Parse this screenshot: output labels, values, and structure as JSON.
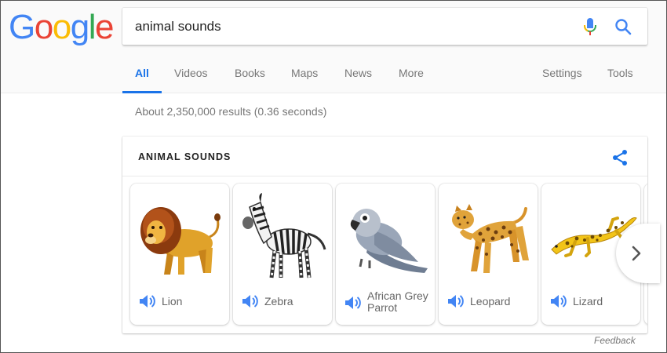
{
  "logo": {
    "text": "Google",
    "letters": [
      "G",
      "o",
      "o",
      "g",
      "l",
      "e"
    ],
    "colors": [
      "#4285f4",
      "#ea4335",
      "#fbbc05",
      "#4285f4",
      "#34a853",
      "#ea4335"
    ]
  },
  "search": {
    "query": "animal sounds",
    "mic_icon": "microphone-icon",
    "search_icon": "magnifier-icon"
  },
  "tabs": {
    "all": "All",
    "videos": "Videos",
    "books": "Books",
    "maps": "Maps",
    "news": "News",
    "more": "More",
    "settings": "Settings",
    "tools": "Tools"
  },
  "result_stats": "About 2,350,000 results (0.36 seconds)",
  "card": {
    "title": "ANIMAL SOUNDS",
    "share_icon": "share-icon",
    "animals": [
      {
        "name": "Lion",
        "icon": "lion-illustration"
      },
      {
        "name": "Zebra",
        "icon": "zebra-illustration"
      },
      {
        "name": "African Grey Parrot",
        "icon": "parrot-illustration"
      },
      {
        "name": "Leopard",
        "icon": "leopard-illustration"
      },
      {
        "name": "Lizard",
        "icon": "lizard-illustration"
      }
    ],
    "next_icon": "chevron-right-icon"
  },
  "feedback": "Feedback",
  "colors": {
    "accent": "#1a73e8",
    "speaker": "#4285f4"
  }
}
